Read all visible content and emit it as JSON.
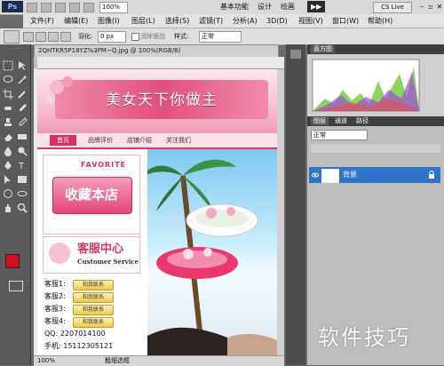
{
  "app": {
    "logo": "Ps",
    "zoom": "100%",
    "workspaces": [
      "基本功能",
      "设计",
      "绘画"
    ],
    "cs_live": "CS Live"
  },
  "menus": [
    "文件(F)",
    "编辑(E)",
    "图像(I)",
    "图层(L)",
    "选择(S)",
    "滤镜(T)",
    "分析(A)",
    "3D(D)",
    "视图(V)",
    "窗口(W)",
    "帮助(H)"
  ],
  "options": {
    "feather_label": "羽化:",
    "feather_value": "0 px",
    "antialias_label": "消除锯齿",
    "style_label": "样式:",
    "style_value": "正常"
  },
  "document": {
    "tab_title": "2QHTKR5P18YZ%3PM~Q.jpg @ 100%(RGB/8)",
    "status_zoom": "100%",
    "status_info": "粗细选框"
  },
  "page": {
    "banner_title": "美女天下你做主",
    "nav": [
      "首页",
      "品牌评价",
      "店铺介绍",
      "关注我们"
    ],
    "favorite_en": "FAVORITE",
    "favorite_cn": "收藏本店",
    "service_cn": "客服中心",
    "service_en": "Customer Service",
    "service_rows": [
      {
        "label": "客服1:",
        "badge": "和我联系"
      },
      {
        "label": "客服2:",
        "badge": "和我联系"
      },
      {
        "label": "客服3:",
        "badge": "和我联系"
      },
      {
        "label": "客服4:",
        "badge": "和我联系"
      }
    ],
    "qq_line": "QQ:  2207014100",
    "phone_line": "手机: 15112305121"
  },
  "panels": {
    "histogram_tab": "直方图",
    "layers_tabs": [
      "图层",
      "通道",
      "路径"
    ],
    "blend_mode": "正常",
    "layer_name": "背景"
  },
  "watermark": "软件技巧",
  "colors": {
    "accent_pink": "#d8315f",
    "foreground": "#d40f1f",
    "background": "#ffffff",
    "selection_blue": "#2f74c9"
  }
}
